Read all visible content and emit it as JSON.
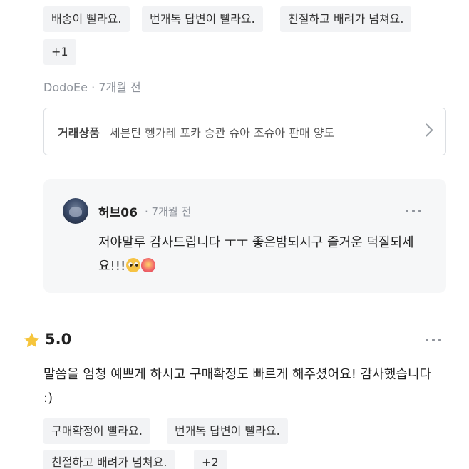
{
  "prev_review": {
    "tags": [
      "배송이 빨라요.",
      "번개톡 답변이 빨라요.",
      "친절하고 배려가 넘쳐요.",
      "+1"
    ],
    "author": "DodoEe",
    "time": "· 7개월 전",
    "product": {
      "label": "거래상품",
      "name": "세븐틴 헹가레 포카 승관 슈아 조슈아 판매 양도"
    },
    "reply": {
      "name": "허브06",
      "time": "· 7개월 전",
      "text": "저야말루 감사드립니다 ㅜㅜ 좋은밤되시구 즐거운 덕질되세요!!!",
      "emojis": [
        "pleading-face-emoji",
        "heart-emoji"
      ]
    }
  },
  "review": {
    "rating": "5.0",
    "text": "말씀을 엄청 예쁘게 하시고 구매확정도 빠르게 해주셨어요! 감사했습니다 :)",
    "tags": [
      "구매확정이 빨라요.",
      "번개톡 답변이 빨라요.",
      "친절하고 배려가 넘쳐요.",
      "+2"
    ]
  },
  "colors": {
    "tag_bg": "#f2f3f5",
    "meta_text": "#8e939b",
    "star": "#f6c53c",
    "reply_bg": "#f6f7f8"
  }
}
